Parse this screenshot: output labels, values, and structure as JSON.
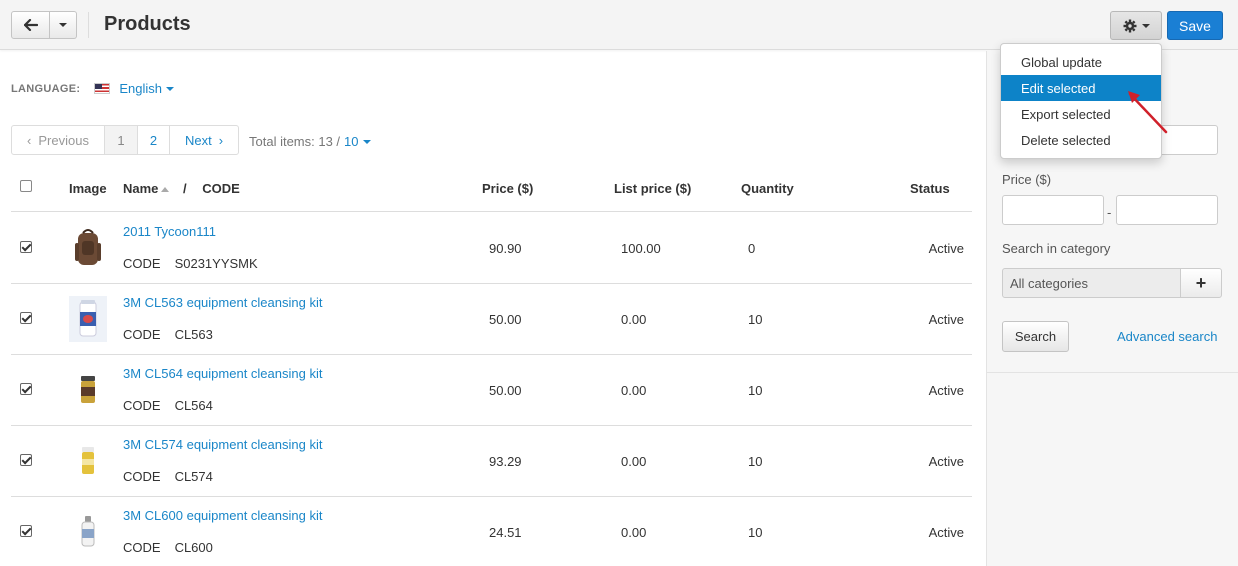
{
  "header": {
    "title": "Products",
    "save_label": "Save"
  },
  "language": {
    "label": "LANGUAGE:",
    "value": "English"
  },
  "pagination": {
    "previous": "Previous",
    "pages": [
      "1",
      "2"
    ],
    "next": "Next",
    "total_label": "Total items: 13 /",
    "per_page": "10"
  },
  "table": {
    "columns": {
      "image": "Image",
      "name": "Name",
      "separator": "/",
      "code": "CODE",
      "price": "Price ($)",
      "list_price": "List price ($)",
      "quantity": "Quantity",
      "status": "Status"
    },
    "code_label": "CODE",
    "rows": [
      {
        "name": "2011 Tycoon111",
        "code": "S0231YYSMK",
        "price": "90.90",
        "list_price": "100.00",
        "quantity": "0",
        "status": "Active",
        "thumb_color": "#6b4a35"
      },
      {
        "name": "3M CL563 equipment cleansing kit",
        "code": "CL563",
        "price": "50.00",
        "list_price": "0.00",
        "quantity": "10",
        "status": "Active",
        "thumb_color": "#3a5fb0"
      },
      {
        "name": "3M CL564 equipment cleansing kit",
        "code": "CL564",
        "price": "50.00",
        "list_price": "0.00",
        "quantity": "10",
        "status": "Active",
        "thumb_color": "#c9a23a"
      },
      {
        "name": "3M CL574 equipment cleansing kit",
        "code": "CL574",
        "price": "93.29",
        "list_price": "0.00",
        "quantity": "10",
        "status": "Active",
        "thumb_color": "#e4c23c"
      },
      {
        "name": "3M CL600 equipment cleansing kit",
        "code": "CL600",
        "price": "24.51",
        "list_price": "0.00",
        "quantity": "10",
        "status": "Active",
        "thumb_color": "#8aa4c8"
      }
    ]
  },
  "sidebar": {
    "price_label": "Price ($)",
    "price_sep": "-",
    "category_label": "Search in category",
    "category_value": "All categories",
    "search_button": "Search",
    "advanced_search": "Advanced search"
  },
  "dropdown": {
    "items": [
      "Global update",
      "Edit selected",
      "Export selected",
      "Delete selected"
    ],
    "active_index": 1
  },
  "colors": {
    "accent": "#1a86c8",
    "save_button": "#1a7fd4",
    "menu_active": "#0d83c8",
    "annotation_arrow": "#d0202a"
  }
}
